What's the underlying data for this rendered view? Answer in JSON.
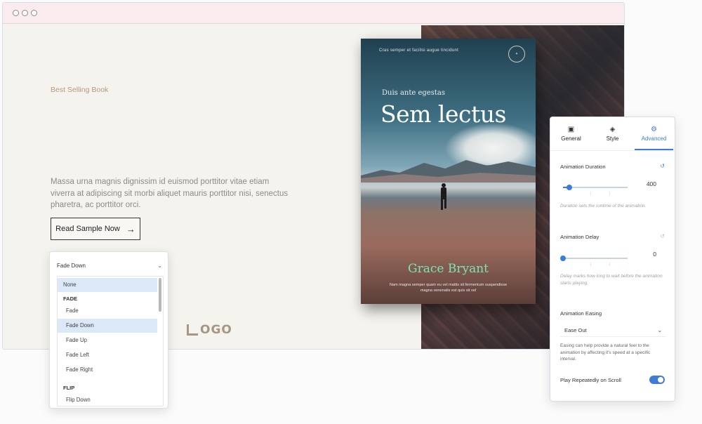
{
  "hero": {
    "eyebrow": "Best Selling Book",
    "body": "Massa urna magnis dignissim id euismod porttitor vitae etiam viverra at adipiscing sit morbi aliquet mauris porttitor nisi, senectus pharetra, ac porttitor orci.",
    "cta_label": "Read Sample Now",
    "logo_text": "OGO"
  },
  "book": {
    "tagline": "Cras semper et facilisi augue tincidunt",
    "subtitle": "Duis ante egestas",
    "title": "Sem lectus",
    "author": "Grace Bryant",
    "blurb": "Nam magna semper quam eu vel mattis sit fermentum suspendisse magna venenatis est quis sit vel"
  },
  "dropdown": {
    "selected": "Fade Down",
    "options": {
      "none": "None",
      "group_fade": "FADE",
      "fade": "Fade",
      "fade_down": "Fade Down",
      "fade_up": "Fade Up",
      "fade_left": "Fade Left",
      "fade_right": "Fade Right",
      "group_flip": "FLIP",
      "flip_down": "Flip Down"
    }
  },
  "panel": {
    "tabs": {
      "general": "General",
      "style": "Style",
      "advanced": "Advanced"
    },
    "active_tab": "Advanced",
    "duration": {
      "label": "Animation Duration",
      "value": "400",
      "level": 0.1,
      "help": "Duration sets the runtime of the animation."
    },
    "delay": {
      "label": "Animation Delay",
      "value": "0",
      "level": 0,
      "help": "Delay marks how long to wait before the animation starts playing."
    },
    "easing": {
      "label": "Animation Easing",
      "value": "Ease Out",
      "help": "Easing can help provide a natural feel to the animation by affecting it's speed at a specific interval."
    },
    "repeat": {
      "label": "Play Repeatedly on Scroll",
      "on": true
    }
  },
  "colors": {
    "accent": "#3d7bd9",
    "author": "#7fe3b1",
    "eyebrow": "#b59a78"
  }
}
